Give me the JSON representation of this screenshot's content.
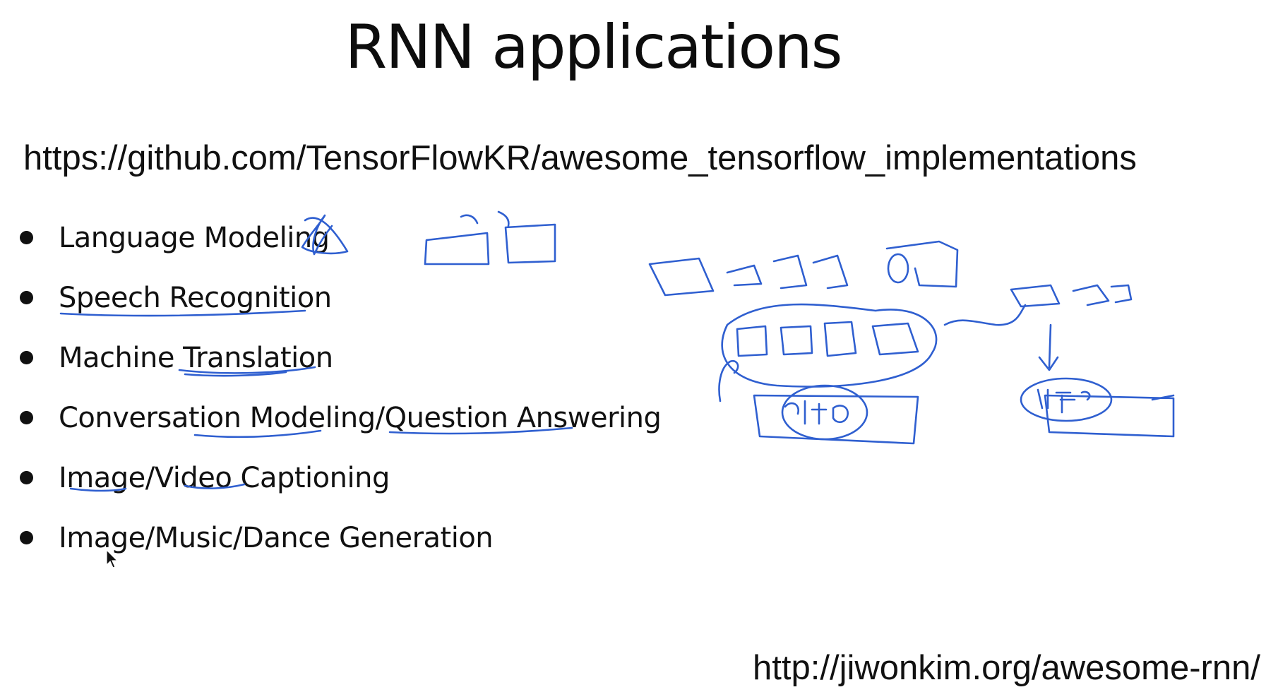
{
  "slide": {
    "title": "RNN applications",
    "repo_url": "https://github.com/TensorFlowKR/awesome_tensorflow_implementations",
    "bullets": [
      "Language Modeling",
      "Speech Recognition",
      "Machine Translation",
      "Conversation Modeling/Question Answering",
      "Image/Video Captioning",
      "Image/Music/Dance Generation"
    ],
    "footer_url": "http://jiwonkim.org/awesome-rnn/"
  },
  "colors": {
    "background": "#ffffff",
    "text": "#111111",
    "annotation_ink": "#2f5fd0"
  },
  "icons": {
    "cursor": "mouse-pointer-icon"
  }
}
